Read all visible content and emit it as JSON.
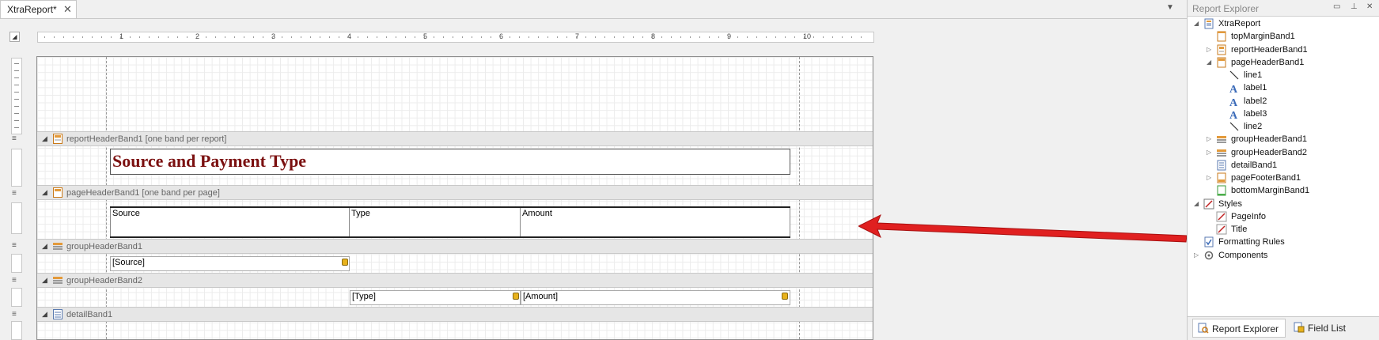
{
  "document_tab": {
    "title": "XtraReport*",
    "close_glyph": "✕"
  },
  "tab_dropdown_glyph": "▼",
  "ruler": {
    "labels": [
      "1",
      "2",
      "3",
      "4",
      "5",
      "6",
      "7",
      "8",
      "9",
      "10"
    ]
  },
  "bands": {
    "report_header": "reportHeaderBand1 [one band per report]",
    "page_header": "pageHeaderBand1 [one band per page]",
    "group_header1": "groupHeaderBand1",
    "group_header2": "groupHeaderBand2",
    "detail": "detailBand1"
  },
  "report": {
    "title": "Source and Payment Type",
    "header_cells": [
      "Source",
      "Type",
      "Amount"
    ],
    "group1_field": "[Source]",
    "group2_fields": [
      "[Type]",
      "[Amount]"
    ]
  },
  "explorer": {
    "title": "Report Explorer",
    "buttons": [
      "▭",
      "⊥",
      "✕"
    ],
    "tree": [
      {
        "label": "XtraReport",
        "indent": 0,
        "expander": "◢",
        "icon": "report-icon"
      },
      {
        "label": "topMarginBand1",
        "indent": 1,
        "expander": "",
        "icon": "top-margin-band-icon"
      },
      {
        "label": "reportHeaderBand1",
        "indent": 1,
        "expander": "▷",
        "icon": "report-header-band-icon"
      },
      {
        "label": "pageHeaderBand1",
        "indent": 1,
        "expander": "◢",
        "icon": "page-header-band-icon"
      },
      {
        "label": "line1",
        "indent": 2,
        "expander": "",
        "icon": "line-icon"
      },
      {
        "label": "label1",
        "indent": 2,
        "expander": "",
        "icon": "label-icon"
      },
      {
        "label": "label2",
        "indent": 2,
        "expander": "",
        "icon": "label-icon"
      },
      {
        "label": "label3",
        "indent": 2,
        "expander": "",
        "icon": "label-icon"
      },
      {
        "label": "line2",
        "indent": 2,
        "expander": "",
        "icon": "line-icon"
      },
      {
        "label": "groupHeaderBand1",
        "indent": 1,
        "expander": "▷",
        "icon": "group-header-band-icon"
      },
      {
        "label": "groupHeaderBand2",
        "indent": 1,
        "expander": "▷",
        "icon": "group-header-band-icon"
      },
      {
        "label": "detailBand1",
        "indent": 1,
        "expander": "",
        "icon": "detail-band-icon"
      },
      {
        "label": "pageFooterBand1",
        "indent": 1,
        "expander": "▷",
        "icon": "page-footer-band-icon"
      },
      {
        "label": "bottomMarginBand1",
        "indent": 1,
        "expander": "",
        "icon": "bottom-margin-band-icon"
      },
      {
        "label": "Styles",
        "indent": 0,
        "expander": "◢",
        "icon": "styles-icon"
      },
      {
        "label": "PageInfo",
        "indent": 1,
        "expander": "",
        "icon": "style-icon"
      },
      {
        "label": "Title",
        "indent": 1,
        "expander": "",
        "icon": "style-icon"
      },
      {
        "label": "Formatting Rules",
        "indent": 0,
        "expander": "",
        "icon": "formatting-rules-icon"
      },
      {
        "label": "Components",
        "indent": 0,
        "expander": "▷",
        "icon": "components-icon"
      }
    ],
    "tabs": [
      "Report Explorer",
      "Field List"
    ]
  },
  "colors": {
    "title_text": "#7b1010",
    "arrow": "#e02020",
    "band_bg": "#e6e6e6"
  }
}
